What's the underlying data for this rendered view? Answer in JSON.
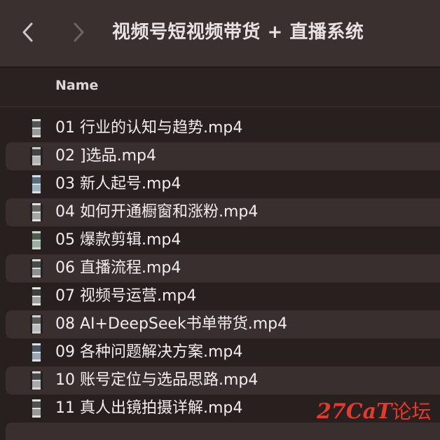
{
  "window": {
    "title": "视频号短视频带货 + 直播系统",
    "back_icon": "chevron-left-icon",
    "forward_icon": "chevron-right-icon"
  },
  "columns": {
    "name": "Name"
  },
  "files": [
    {
      "label": "01 行业的认知与趋势.mp4",
      "icon": "video-file-icon"
    },
    {
      "label": "02 ]选品.mp4",
      "icon": "video-file-icon"
    },
    {
      "label": "03 新人起号.mp4",
      "icon": "video-file-icon"
    },
    {
      "label": "04 如何开通橱窗和涨粉.mp4",
      "icon": "video-file-icon"
    },
    {
      "label": "05 爆款剪辑.mp4",
      "icon": "video-file-icon"
    },
    {
      "label": "06 直播流程.mp4",
      "icon": "video-file-icon"
    },
    {
      "label": "07 视频号运营.mp4",
      "icon": "video-file-icon"
    },
    {
      "label": "08 AI+DeepSeek书单带货.mp4",
      "icon": "video-file-icon"
    },
    {
      "label": "09 各种问题解决方案.mp4",
      "icon": "video-file-icon"
    },
    {
      "label": "10 账号定位与选品思路.mp4",
      "icon": "video-file-icon"
    },
    {
      "label": "11 真人出镜拍摄详解.mp4",
      "icon": "video-file-icon"
    }
  ],
  "watermark": {
    "latin": "27CaT",
    "cjk": "论坛"
  },
  "colors": {
    "toolbar_bg": "#3a3030",
    "list_bg": "#281f1f",
    "row_alt_bg": "#3a2f2f",
    "text": "#f2eeee",
    "watermark": "#e5392c"
  }
}
